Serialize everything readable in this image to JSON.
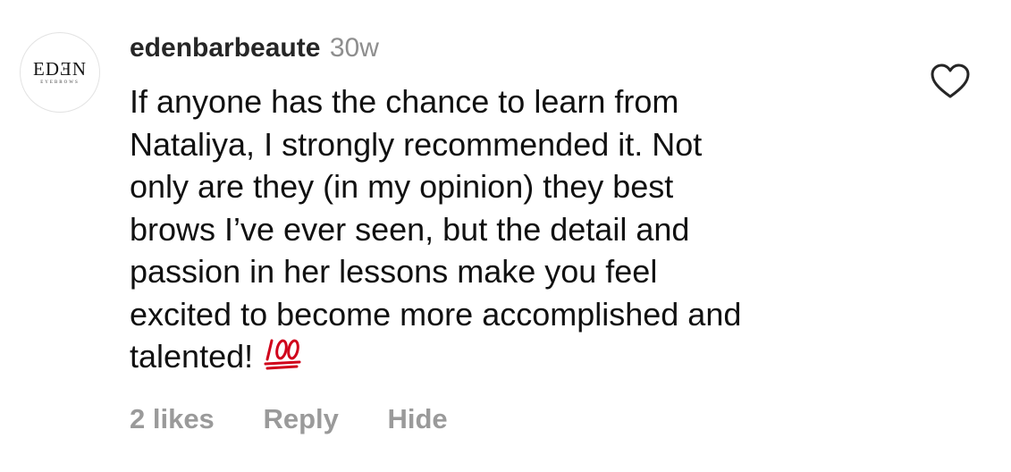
{
  "avatar": {
    "logo_text": "EDƎN",
    "logo_subtext": "EYEBROWS"
  },
  "comment": {
    "username": "edenbarbeaute",
    "timestamp": "30w",
    "text": "If anyone has the chance to learn from\nNataliya, I strongly recommended it. Not\nonly are they (in my opinion) they best\nbrows I’ve ever seen, but the detail and\npassion in her lessons make you feel\nexcited to become more accomplished and\ntalented!",
    "emoji": "hundred-points-emoji"
  },
  "actions": {
    "likes_label": "2 likes",
    "reply_label": "Reply",
    "hide_label": "Hide"
  },
  "icons": {
    "like": "heart-outline-icon"
  },
  "colors": {
    "username": "#262626",
    "secondary": "#8e8e8e",
    "action_text": "#9a9a9a",
    "emoji_red": "#d0021b"
  }
}
